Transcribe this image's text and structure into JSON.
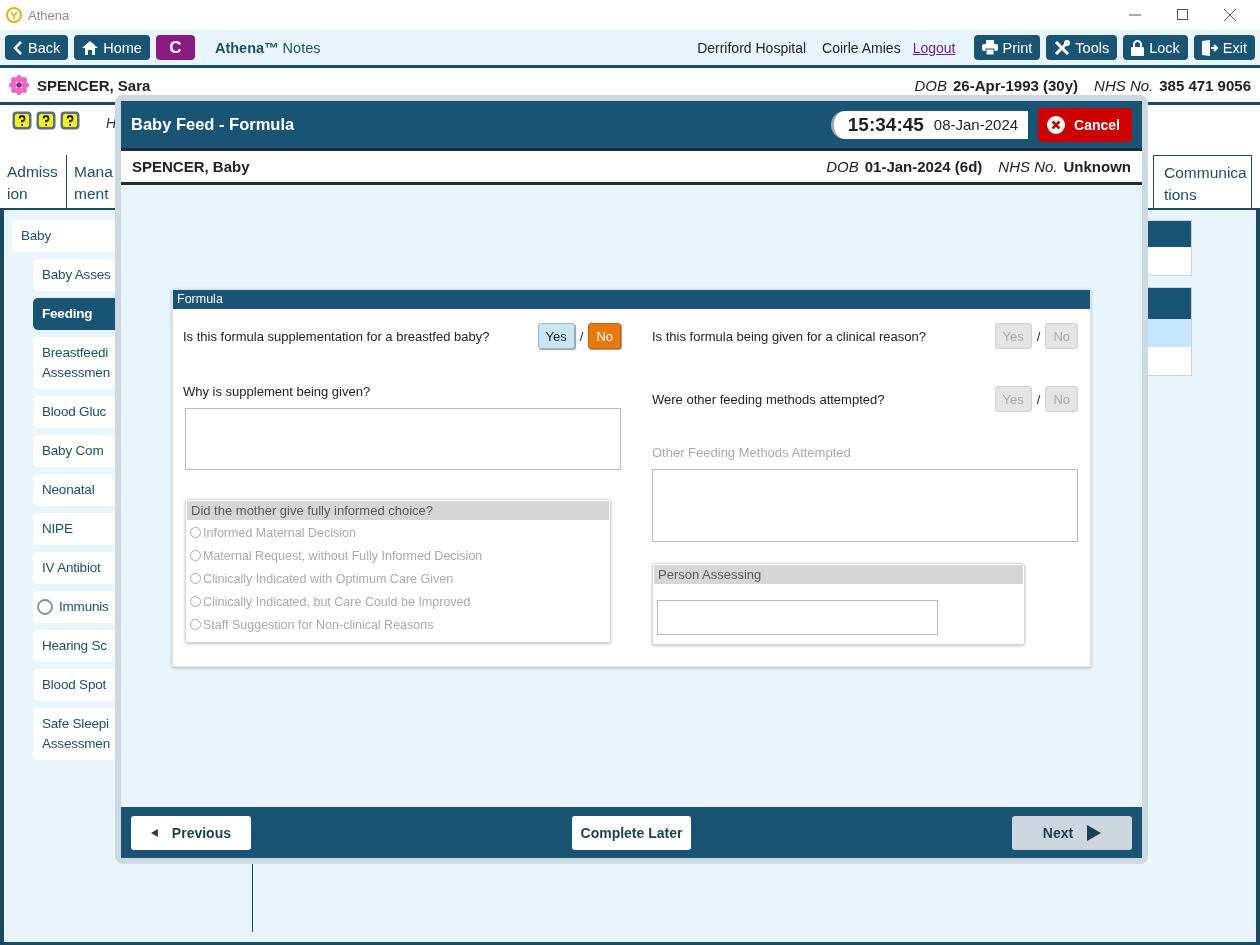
{
  "window": {
    "title": "Athena"
  },
  "toolbar": {
    "nav": [
      {
        "label": "Back"
      },
      {
        "label": "Home"
      }
    ],
    "badge": "C",
    "app_name": "**Athena™** Notes",
    "site": "Derriford Hospital",
    "user": "Coirle Amies",
    "logout": "Logout",
    "actions": [
      {
        "label": "Print"
      },
      {
        "label": "Tools"
      },
      {
        "label": "Lock"
      },
      {
        "label": "Exit"
      }
    ]
  },
  "patient": {
    "name": "SPENCER, Sara",
    "dob_label": "DOB",
    "dob": "26-Apr-1993 (30y)",
    "nhs_label": "NHS No.",
    "nhs": "385 471 9056"
  },
  "alert_text": "H",
  "tabs": [
    {
      "lines": [
        "Admiss",
        "ion"
      ]
    },
    {
      "lines": [
        "Mana",
        "ment"
      ]
    },
    {
      "lines": [
        "Communica",
        "tions"
      ]
    }
  ],
  "sidebar": {
    "group": "Baby",
    "items": [
      {
        "lines": [
          "Baby Asses"
        ],
        "selected": false,
        "kind": "plain"
      },
      {
        "lines": [
          "Feeding"
        ],
        "selected": true,
        "kind": "plain"
      },
      {
        "lines": [
          "Breastfeedi",
          "Assessmen"
        ],
        "selected": false,
        "kind": "plain"
      },
      {
        "lines": [
          "Blood Gluc"
        ],
        "selected": false,
        "kind": "plain"
      },
      {
        "lines": [
          "Baby Com"
        ],
        "selected": false,
        "kind": "plain"
      },
      {
        "lines": [
          "Neonatal"
        ],
        "selected": false,
        "kind": "plain"
      },
      {
        "lines": [
          "NIPE"
        ],
        "selected": false,
        "kind": "plain"
      },
      {
        "lines": [
          "IV Antibiot"
        ],
        "selected": false,
        "kind": "plain"
      },
      {
        "lines": [
          "Immunis"
        ],
        "selected": false,
        "kind": "status"
      },
      {
        "lines": [
          "Hearing Sc"
        ],
        "selected": false,
        "kind": "plain"
      },
      {
        "lines": [
          "Blood Spot"
        ],
        "selected": false,
        "kind": "plain"
      },
      {
        "lines": [
          "Safe Sleepi",
          "Assessmen"
        ],
        "selected": false,
        "kind": "plain"
      }
    ]
  },
  "modal": {
    "title": "Baby Feed - Formula",
    "time": "15:34:45",
    "date": "08-Jan-2024",
    "cancel": "Cancel",
    "patient": {
      "name": "SPENCER, Baby",
      "dob_label": "DOB",
      "dob": "01-Jan-2024 (6d)",
      "nhs_label": "NHS No.",
      "nhs": "Unknown"
    },
    "section": {
      "title": "Formula",
      "left": [
        {
          "kind": "yesno",
          "question": "Is this formula supplementation for a breastfed baby?",
          "disabled": false,
          "separator": "/",
          "options": [
            {
              "label": "Yes",
              "selected": false
            },
            {
              "label": "No",
              "selected": true
            }
          ]
        },
        {
          "kind": "textarea",
          "label": "Why is supplement being given?",
          "disabled": false
        },
        {
          "kind": "radiogroup",
          "title": "Did the mother give fully informed choice?",
          "disabled": true,
          "options": [
            {
              "label": "Informed Maternal Decision",
              "selected": false
            },
            {
              "label": "Maternal Request, without Fully Informed Decision",
              "selected": false
            },
            {
              "label": "Clinically Indicated with Optimum Care Given",
              "selected": false
            },
            {
              "label": "Clinically Indicated, but Care Could be Improved",
              "selected": false
            },
            {
              "label": "Staff Suggestion for Non-clinical Reasons",
              "selected": false
            }
          ]
        }
      ],
      "right": [
        {
          "kind": "yesno",
          "question": "Is this formula being given for a clinical reason?",
          "disabled": true,
          "separator": "/",
          "options": [
            {
              "label": "Yes",
              "selected": false
            },
            {
              "label": "No",
              "selected": false
            }
          ]
        },
        {
          "kind": "yesno",
          "question": "Were other feeding methods attempted?",
          "disabled": true,
          "separator": "/",
          "options": [
            {
              "label": "Yes",
              "selected": false
            },
            {
              "label": "No",
              "selected": false
            }
          ]
        },
        {
          "kind": "textarea",
          "label": "Other Feeding Methods Attempted",
          "disabled": true
        },
        {
          "kind": "fieldbox",
          "title": "Person Assessing",
          "disabled": true
        }
      ]
    },
    "footer": {
      "previous": {
        "label": "Previous",
        "disabled": false
      },
      "complete": {
        "label": "Complete Later",
        "disabled": false
      },
      "next": {
        "label": "Next",
        "disabled": true
      }
    }
  }
}
